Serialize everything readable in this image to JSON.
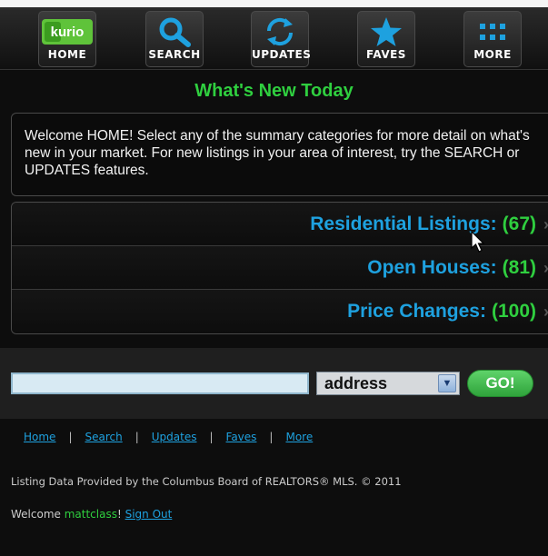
{
  "nav": {
    "items": [
      {
        "label": "HOME",
        "icon": "kurio-logo"
      },
      {
        "label": "SEARCH",
        "icon": "search-icon"
      },
      {
        "label": "UPDATES",
        "icon": "refresh-icon"
      },
      {
        "label": "FAVES",
        "icon": "star-icon"
      },
      {
        "label": "MORE",
        "icon": "more-dots-icon"
      }
    ],
    "logo_text": "kurio"
  },
  "page": {
    "title": "What's New Today",
    "welcome_text": "Welcome HOME! Select any of the summary categories for more detail on what's new in your market. For new listings in your area of interest, try the SEARCH or UPDATES features."
  },
  "summary": [
    {
      "label": "Residential Listings:",
      "count": "(67)"
    },
    {
      "label": "Open Houses:",
      "count": "(81)"
    },
    {
      "label": "Price Changes:",
      "count": "(100)"
    }
  ],
  "search": {
    "input_value": "",
    "select_value": "address",
    "go_label": "GO!"
  },
  "footer": {
    "links": [
      "Home",
      "Search",
      "Updates",
      "Faves",
      "More"
    ],
    "separator": "|",
    "credit": "Listing Data Provided by the Columbus Board of REALTORS® MLS. © 2011",
    "welcome_prefix": "Welcome ",
    "username": "mattclass",
    "after_username": "! ",
    "signout": "Sign Out"
  },
  "colors": {
    "accent_green": "#2fcf3f",
    "accent_blue": "#1ea1df",
    "background": "#0d0d0d"
  }
}
